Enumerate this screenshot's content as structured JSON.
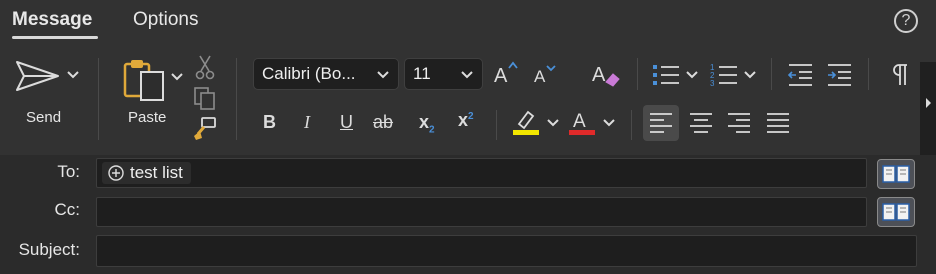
{
  "tabs": [
    {
      "label": "Message",
      "active": true
    },
    {
      "label": "Options",
      "active": false
    }
  ],
  "help_label": "?",
  "send": {
    "label": "Send"
  },
  "paste": {
    "label": "Paste"
  },
  "font": {
    "family": "Calibri (Bo...",
    "size": "11"
  },
  "format_buttons": {
    "bold": "B",
    "italic": "I",
    "underline": "U",
    "strike": "ab",
    "subscript": "x",
    "superscript": "x"
  },
  "colors": {
    "highlight": "#f2e600",
    "font_color": "#e02a2a",
    "accent": "#4a90d9"
  },
  "fields": {
    "to_label": "To:",
    "cc_label": "Cc:",
    "subject_label": "Subject:",
    "to_recipient": "test list"
  }
}
